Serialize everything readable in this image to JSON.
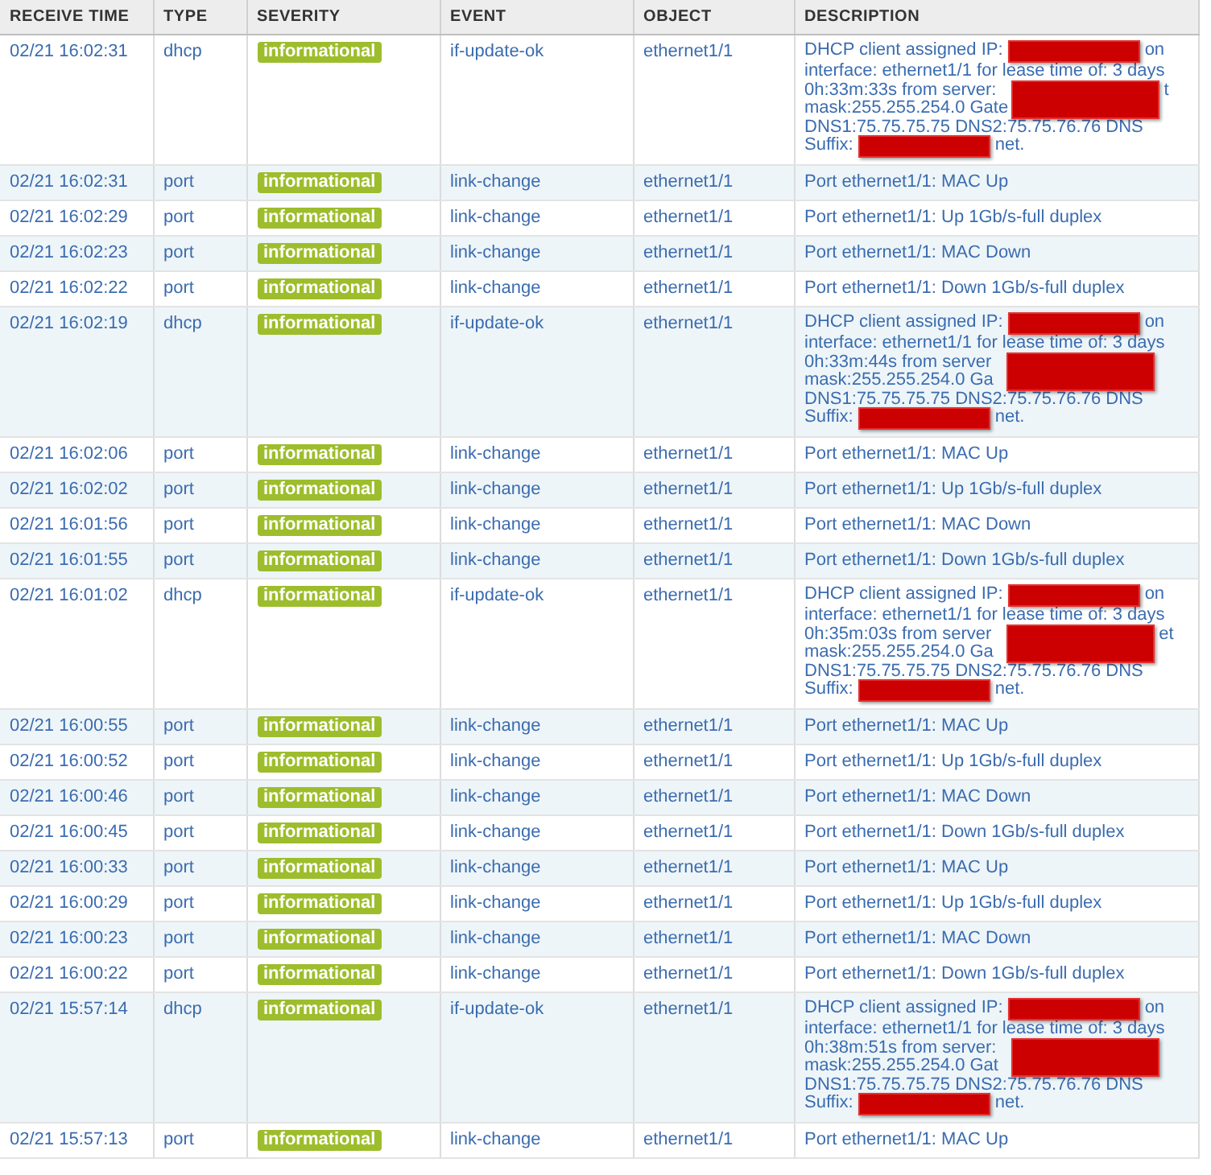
{
  "table": {
    "columns": [
      "RECEIVE TIME",
      "TYPE",
      "SEVERITY",
      "EVENT",
      "OBJECT",
      "DESCRIPTION"
    ],
    "rows": [
      {
        "time": "02/21 16:02:31",
        "type": "dhcp",
        "severity": "informational",
        "event": "if-update-ok",
        "object": "ethernet1/1",
        "description": [
          [
            {
              "kind": "text",
              "text": "DHCP client assigned IP:"
            },
            {
              "kind": "redaction"
            },
            {
              "kind": "text",
              "text": "on"
            }
          ],
          [
            {
              "kind": "text",
              "text": "interface: ethernet1/1 for lease time of: 3 days"
            }
          ],
          [
            {
              "kind": "text",
              "text": "0h:33m:33s from server:"
            },
            {
              "kind": "redaction_tall"
            },
            {
              "kind": "text",
              "text": "t"
            }
          ],
          [
            {
              "kind": "text",
              "text": "mask:255.255.254.0 Gate"
            }
          ],
          [
            {
              "kind": "text",
              "text": "DNS1:75.75.75.75 DNS2:75.75.76.76 DNS"
            }
          ],
          [
            {
              "kind": "text",
              "text": "Suffix:"
            },
            {
              "kind": "redaction"
            },
            {
              "kind": "text",
              "text": "net."
            }
          ]
        ]
      },
      {
        "time": "02/21 16:02:31",
        "type": "port",
        "severity": "informational",
        "event": "link-change",
        "object": "ethernet1/1",
        "description": [
          [
            {
              "kind": "text",
              "text": "Port ethernet1/1: MAC Up"
            }
          ]
        ]
      },
      {
        "time": "02/21 16:02:29",
        "type": "port",
        "severity": "informational",
        "event": "link-change",
        "object": "ethernet1/1",
        "description": [
          [
            {
              "kind": "text",
              "text": "Port ethernet1/1: Up 1Gb/s-full duplex"
            }
          ]
        ]
      },
      {
        "time": "02/21 16:02:23",
        "type": "port",
        "severity": "informational",
        "event": "link-change",
        "object": "ethernet1/1",
        "description": [
          [
            {
              "kind": "text",
              "text": "Port ethernet1/1: MAC Down"
            }
          ]
        ]
      },
      {
        "time": "02/21 16:02:22",
        "type": "port",
        "severity": "informational",
        "event": "link-change",
        "object": "ethernet1/1",
        "description": [
          [
            {
              "kind": "text",
              "text": "Port ethernet1/1: Down 1Gb/s-full duplex"
            }
          ]
        ]
      },
      {
        "time": "02/21 16:02:19",
        "type": "dhcp",
        "severity": "informational",
        "event": "if-update-ok",
        "object": "ethernet1/1",
        "description": [
          [
            {
              "kind": "text",
              "text": "DHCP client assigned IP:"
            },
            {
              "kind": "redaction"
            },
            {
              "kind": "text",
              "text": "on"
            }
          ],
          [
            {
              "kind": "text",
              "text": "interface: ethernet1/1 for lease time of: 3 days"
            }
          ],
          [
            {
              "kind": "text",
              "text": "0h:33m:44s from server"
            },
            {
              "kind": "redaction_tall"
            }
          ],
          [
            {
              "kind": "text",
              "text": "mask:255.255.254.0 Ga"
            }
          ],
          [
            {
              "kind": "text",
              "text": "DNS1:75.75.75.75 DNS2:75.75.76.76 DNS"
            }
          ],
          [
            {
              "kind": "text",
              "text": "Suffix:"
            },
            {
              "kind": "redaction"
            },
            {
              "kind": "text",
              "text": "net."
            }
          ]
        ]
      },
      {
        "time": "02/21 16:02:06",
        "type": "port",
        "severity": "informational",
        "event": "link-change",
        "object": "ethernet1/1",
        "description": [
          [
            {
              "kind": "text",
              "text": "Port ethernet1/1: MAC Up"
            }
          ]
        ]
      },
      {
        "time": "02/21 16:02:02",
        "type": "port",
        "severity": "informational",
        "event": "link-change",
        "object": "ethernet1/1",
        "description": [
          [
            {
              "kind": "text",
              "text": "Port ethernet1/1: Up 1Gb/s-full duplex"
            }
          ]
        ]
      },
      {
        "time": "02/21 16:01:56",
        "type": "port",
        "severity": "informational",
        "event": "link-change",
        "object": "ethernet1/1",
        "description": [
          [
            {
              "kind": "text",
              "text": "Port ethernet1/1: MAC Down"
            }
          ]
        ]
      },
      {
        "time": "02/21 16:01:55",
        "type": "port",
        "severity": "informational",
        "event": "link-change",
        "object": "ethernet1/1",
        "description": [
          [
            {
              "kind": "text",
              "text": "Port ethernet1/1: Down 1Gb/s-full duplex"
            }
          ]
        ]
      },
      {
        "time": "02/21 16:01:02",
        "type": "dhcp",
        "severity": "informational",
        "event": "if-update-ok",
        "object": "ethernet1/1",
        "description": [
          [
            {
              "kind": "text",
              "text": "DHCP client assigned IP:"
            },
            {
              "kind": "redaction"
            },
            {
              "kind": "text",
              "text": "on"
            }
          ],
          [
            {
              "kind": "text",
              "text": "interface: ethernet1/1 for lease time of: 3 days"
            }
          ],
          [
            {
              "kind": "text",
              "text": "0h:35m:03s from server"
            },
            {
              "kind": "redaction_tall"
            },
            {
              "kind": "text",
              "text": "et"
            }
          ],
          [
            {
              "kind": "text",
              "text": "mask:255.255.254.0 Ga"
            }
          ],
          [
            {
              "kind": "text",
              "text": "DNS1:75.75.75.75 DNS2:75.75.76.76 DNS"
            }
          ],
          [
            {
              "kind": "text",
              "text": "Suffix:"
            },
            {
              "kind": "redaction"
            },
            {
              "kind": "text",
              "text": "net."
            }
          ]
        ]
      },
      {
        "time": "02/21 16:00:55",
        "type": "port",
        "severity": "informational",
        "event": "link-change",
        "object": "ethernet1/1",
        "description": [
          [
            {
              "kind": "text",
              "text": "Port ethernet1/1: MAC Up"
            }
          ]
        ]
      },
      {
        "time": "02/21 16:00:52",
        "type": "port",
        "severity": "informational",
        "event": "link-change",
        "object": "ethernet1/1",
        "description": [
          [
            {
              "kind": "text",
              "text": "Port ethernet1/1: Up 1Gb/s-full duplex"
            }
          ]
        ]
      },
      {
        "time": "02/21 16:00:46",
        "type": "port",
        "severity": "informational",
        "event": "link-change",
        "object": "ethernet1/1",
        "description": [
          [
            {
              "kind": "text",
              "text": "Port ethernet1/1: MAC Down"
            }
          ]
        ]
      },
      {
        "time": "02/21 16:00:45",
        "type": "port",
        "severity": "informational",
        "event": "link-change",
        "object": "ethernet1/1",
        "description": [
          [
            {
              "kind": "text",
              "text": "Port ethernet1/1: Down 1Gb/s-full duplex"
            }
          ]
        ]
      },
      {
        "time": "02/21 16:00:33",
        "type": "port",
        "severity": "informational",
        "event": "link-change",
        "object": "ethernet1/1",
        "description": [
          [
            {
              "kind": "text",
              "text": "Port ethernet1/1: MAC Up"
            }
          ]
        ]
      },
      {
        "time": "02/21 16:00:29",
        "type": "port",
        "severity": "informational",
        "event": "link-change",
        "object": "ethernet1/1",
        "description": [
          [
            {
              "kind": "text",
              "text": "Port ethernet1/1: Up 1Gb/s-full duplex"
            }
          ]
        ]
      },
      {
        "time": "02/21 16:00:23",
        "type": "port",
        "severity": "informational",
        "event": "link-change",
        "object": "ethernet1/1",
        "description": [
          [
            {
              "kind": "text",
              "text": "Port ethernet1/1: MAC Down"
            }
          ]
        ]
      },
      {
        "time": "02/21 16:00:22",
        "type": "port",
        "severity": "informational",
        "event": "link-change",
        "object": "ethernet1/1",
        "description": [
          [
            {
              "kind": "text",
              "text": "Port ethernet1/1: Down 1Gb/s-full duplex"
            }
          ]
        ]
      },
      {
        "time": "02/21 15:57:14",
        "type": "dhcp",
        "severity": "informational",
        "event": "if-update-ok",
        "object": "ethernet1/1",
        "description": [
          [
            {
              "kind": "text",
              "text": "DHCP client assigned IP:"
            },
            {
              "kind": "redaction"
            },
            {
              "kind": "text",
              "text": "on"
            }
          ],
          [
            {
              "kind": "text",
              "text": "interface: ethernet1/1 for lease time of: 3 days"
            }
          ],
          [
            {
              "kind": "text",
              "text": "0h:38m:51s from server:"
            },
            {
              "kind": "redaction_tall"
            }
          ],
          [
            {
              "kind": "text",
              "text": "mask:255.255.254.0 Gat"
            }
          ],
          [
            {
              "kind": "text",
              "text": "DNS1:75.75.75.75 DNS2:75.75.76.76 DNS"
            }
          ],
          [
            {
              "kind": "text",
              "text": "Suffix:"
            },
            {
              "kind": "redaction"
            },
            {
              "kind": "text",
              "text": "net."
            }
          ]
        ]
      },
      {
        "time": "02/21 15:57:13",
        "type": "port",
        "severity": "informational",
        "event": "link-change",
        "object": "ethernet1/1",
        "description": [
          [
            {
              "kind": "text",
              "text": "Port ethernet1/1: MAC Up"
            }
          ]
        ]
      }
    ]
  }
}
